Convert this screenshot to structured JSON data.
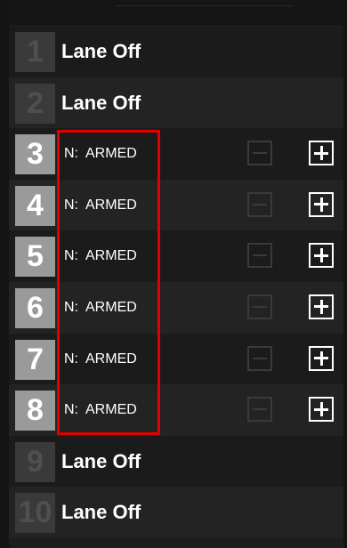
{
  "lanes": [
    {
      "number": "1",
      "state": "off",
      "label": "Lane Off"
    },
    {
      "number": "2",
      "state": "off",
      "label": "Lane Off"
    },
    {
      "number": "3",
      "state": "armed",
      "status": "N:  ARMED"
    },
    {
      "number": "4",
      "state": "armed",
      "status": "N:  ARMED"
    },
    {
      "number": "5",
      "state": "armed",
      "status": "N:  ARMED"
    },
    {
      "number": "6",
      "state": "armed",
      "status": "N:  ARMED"
    },
    {
      "number": "7",
      "state": "armed",
      "status": "N:  ARMED"
    },
    {
      "number": "8",
      "state": "armed",
      "status": "N:  ARMED"
    },
    {
      "number": "9",
      "state": "off",
      "label": "Lane Off"
    },
    {
      "number": "10",
      "state": "off",
      "label": "Lane Off"
    }
  ],
  "icons": {
    "minus": "minus-square-icon",
    "plus": "plus-square-icon"
  },
  "colors": {
    "highlight": "#e00000",
    "active_number_bg": "#9a9a9a",
    "inactive_number_bg": "#3a3a3a"
  }
}
